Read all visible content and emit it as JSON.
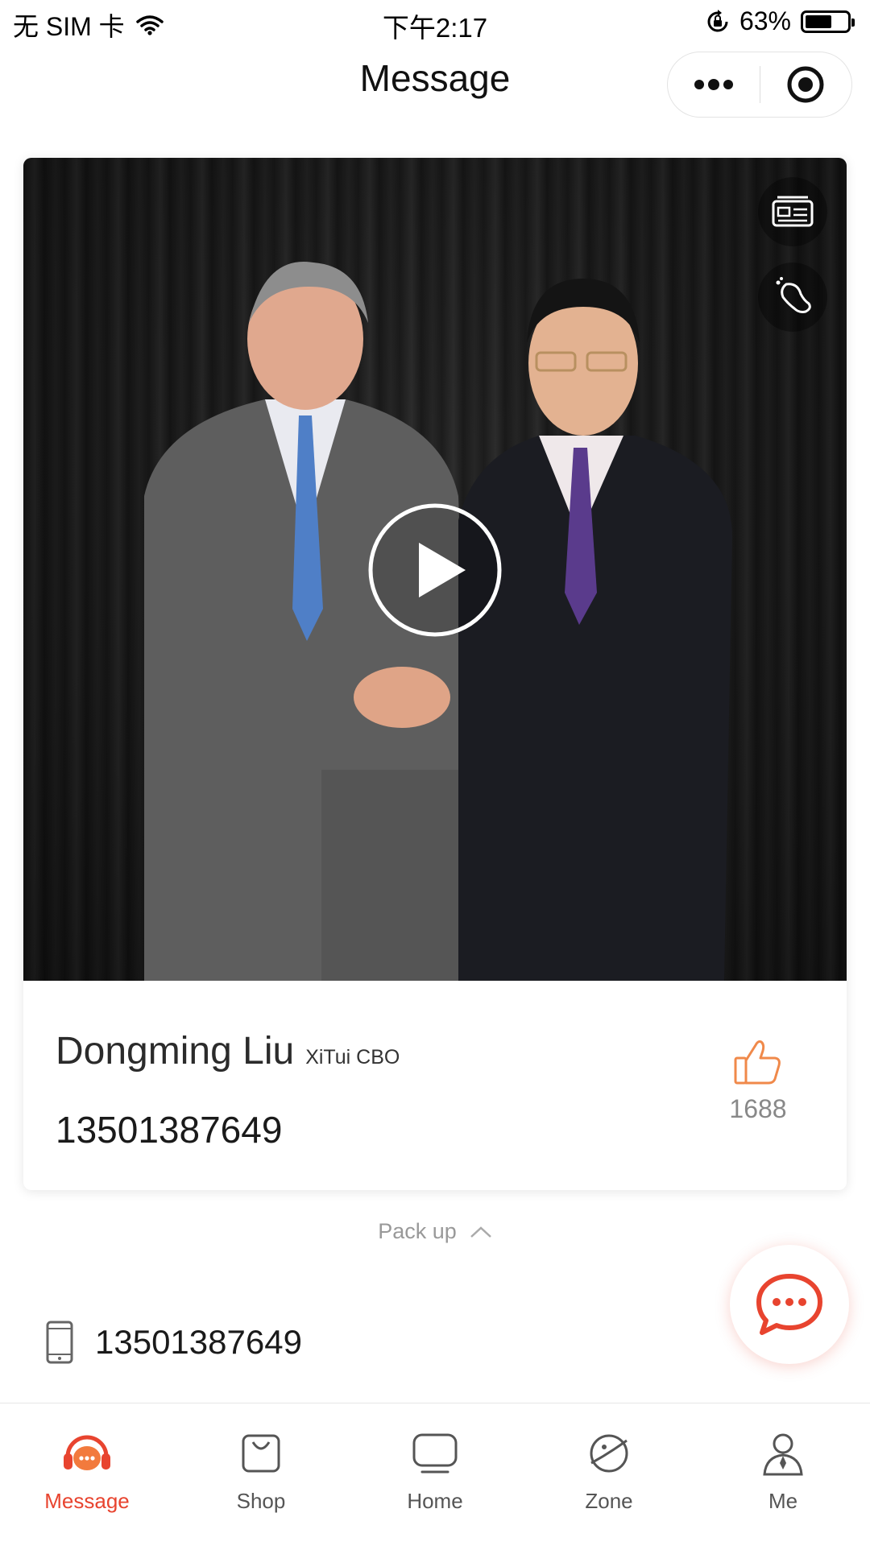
{
  "status_bar": {
    "carrier": "无 SIM 卡",
    "time": "下午2:17",
    "battery_percent": "63%",
    "battery_level": 0.63
  },
  "nav": {
    "title": "Message",
    "more_icon": "more-dots-icon",
    "close_icon": "target-icon"
  },
  "card": {
    "media": {
      "play_icon": "play-icon",
      "side_buttons": [
        "card-icon",
        "footprint-icon"
      ]
    },
    "name": "Dongming Liu",
    "title_tag": "XiTui CBO",
    "phone": "13501387649",
    "likes": "1688",
    "like_icon": "thumbs-up-icon"
  },
  "pack_up": {
    "label": "Pack up",
    "icon": "chevron-up-icon"
  },
  "contact": {
    "phone": "13501387649",
    "icon": "mobile-phone-icon"
  },
  "chat_fab": {
    "icon": "chat-bubble-icon"
  },
  "tabs": [
    {
      "label": "Message",
      "icon": "headset-icon",
      "active": true
    },
    {
      "label": "Shop",
      "icon": "shopping-bag-icon",
      "active": false
    },
    {
      "label": "Home",
      "icon": "home-screen-icon",
      "active": false
    },
    {
      "label": "Zone",
      "icon": "planet-icon",
      "active": false
    },
    {
      "label": "Me",
      "icon": "user-icon",
      "active": false
    }
  ],
  "colors": {
    "accent": "#e8442f",
    "like": "#f0894a",
    "text": "#111111",
    "muted": "#999999"
  }
}
